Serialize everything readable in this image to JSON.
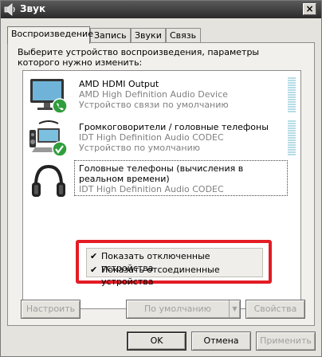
{
  "window": {
    "title": "Звук",
    "close_glyph": "×"
  },
  "tabs": [
    {
      "label": "Воспроизведение",
      "active": true
    },
    {
      "label": "Запись"
    },
    {
      "label": "Звуки"
    },
    {
      "label": "Связь"
    }
  ],
  "instruction": "Выберите устройство воспроизведения, параметры которого нужно изменить:",
  "devices": [
    {
      "name": "AMD HDMI Output",
      "driver": "AMD High Definition Audio Device",
      "status": "Устройство связи по умолчанию",
      "icon": "monitor-icon",
      "badge": "phone-badge-icon"
    },
    {
      "name": "Громкоговорители / головные телефоны",
      "driver": "IDT High Definition Audio CODEC",
      "status": "Устройство по умолчанию",
      "icon": "laptop-speakers-icon",
      "badge": "checkmark-badge-icon"
    },
    {
      "name": "Головные телефоны (вычисления в реальном времени)",
      "driver": "IDT High Definition Audio CODEC",
      "icon": "headphones-icon"
    }
  ],
  "context_menu": {
    "items": [
      {
        "label": "Показать отключенные устройства",
        "checked": true
      },
      {
        "label": "Показать отсоединенные устройства",
        "checked": true
      }
    ],
    "check_glyph": "✔",
    "highlight_color": "#e31c25"
  },
  "buttons": {
    "configure": "Настроить",
    "default": "По умолчанию",
    "properties": "Свойства",
    "ok": "OK",
    "cancel": "Отмена",
    "apply": "Применить"
  }
}
